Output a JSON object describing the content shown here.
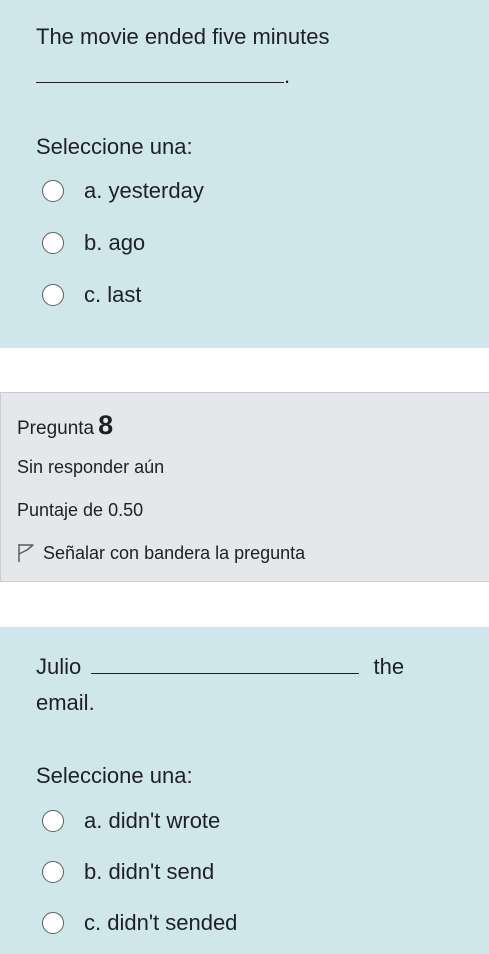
{
  "question7": {
    "text_line1": "The movie ended five minutes",
    "text_end": ".",
    "prompt": "Seleccione una:",
    "options": [
      {
        "label": "a. yesterday"
      },
      {
        "label": "b. ago"
      },
      {
        "label": "c. last"
      }
    ]
  },
  "question8_info": {
    "label": "Pregunta",
    "number": "8",
    "state": "Sin responder aún",
    "grade": "Puntaje de 0.50",
    "flag_label": "Señalar con bandera la pregunta",
    "flag_icon": "flag-icon"
  },
  "question8": {
    "text_start": "Julio",
    "text_after_blank": "the",
    "text_line2": "email.",
    "prompt": "Seleccione una:",
    "options": [
      {
        "label": "a. didn't wrote"
      },
      {
        "label": "b. didn't send"
      },
      {
        "label": "c. didn't sended"
      }
    ]
  },
  "colors": {
    "question_bg": "#cfe6ea",
    "info_bg": "#e5e7ea"
  }
}
